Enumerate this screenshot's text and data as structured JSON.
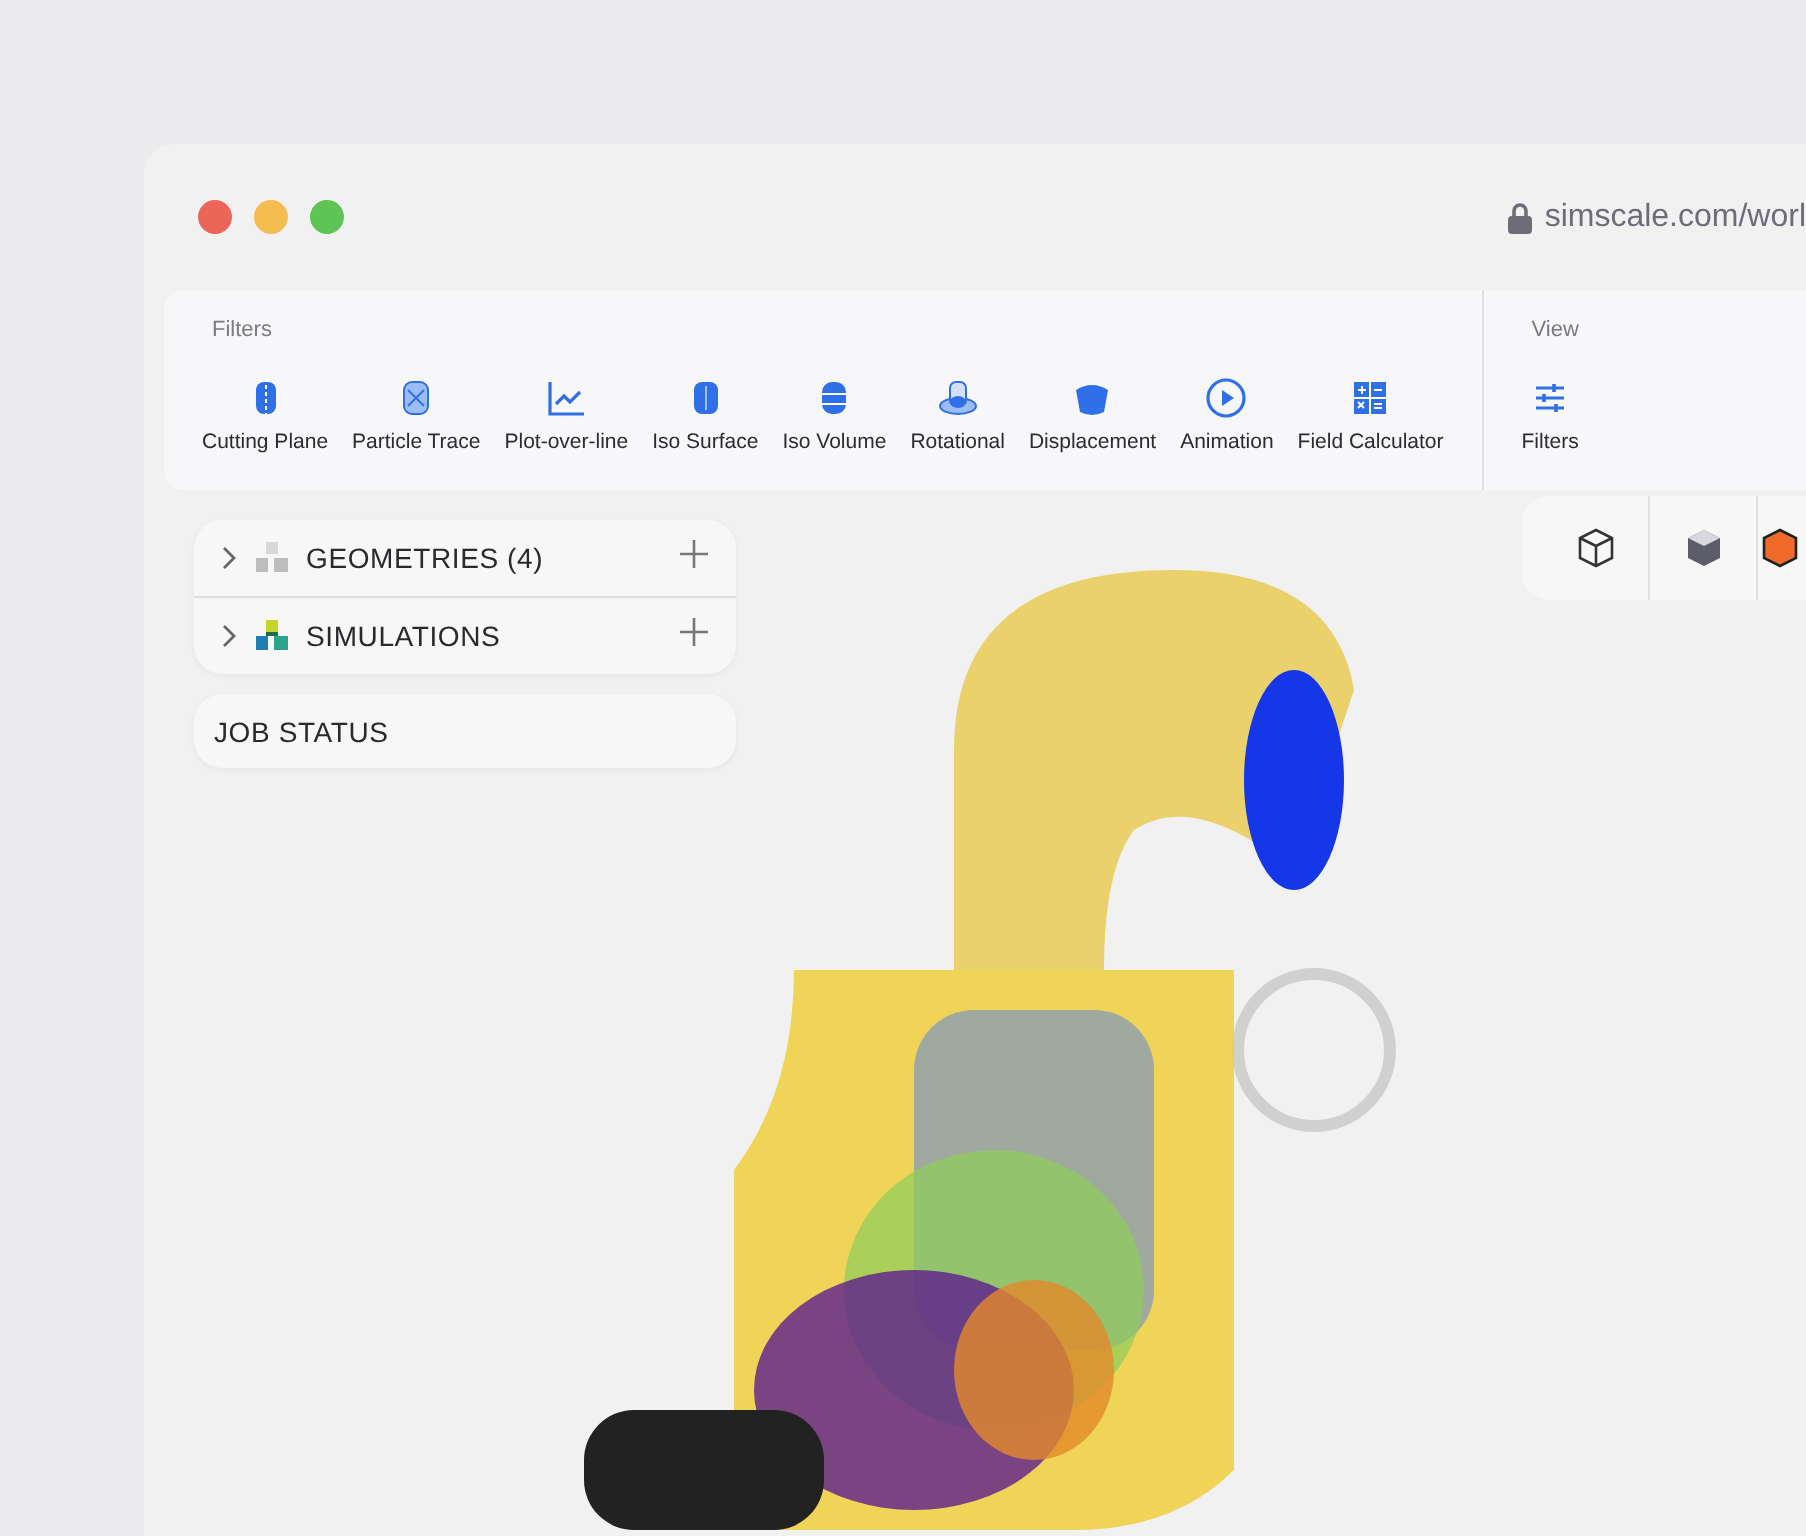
{
  "address_bar": {
    "url": "simscale.com/worl"
  },
  "toolbar": {
    "sections": [
      {
        "title": "Filters",
        "items": [
          {
            "label": "Cutting Plane"
          },
          {
            "label": "Particle Trace"
          },
          {
            "label": "Plot-over-line"
          },
          {
            "label": "Iso Surface"
          },
          {
            "label": "Iso Volume"
          },
          {
            "label": "Rotational"
          },
          {
            "label": "Displacement"
          },
          {
            "label": "Animation"
          },
          {
            "label": "Field Calculator"
          }
        ]
      },
      {
        "title": "View",
        "items": [
          {
            "label": "Filters"
          }
        ]
      }
    ]
  },
  "tree": [
    {
      "label": "GEOMETRIES",
      "count": "(4)",
      "expanded": false
    },
    {
      "label": "SIMULATIONS",
      "expanded": false
    }
  ],
  "job_status": {
    "label": "JOB STATUS"
  }
}
